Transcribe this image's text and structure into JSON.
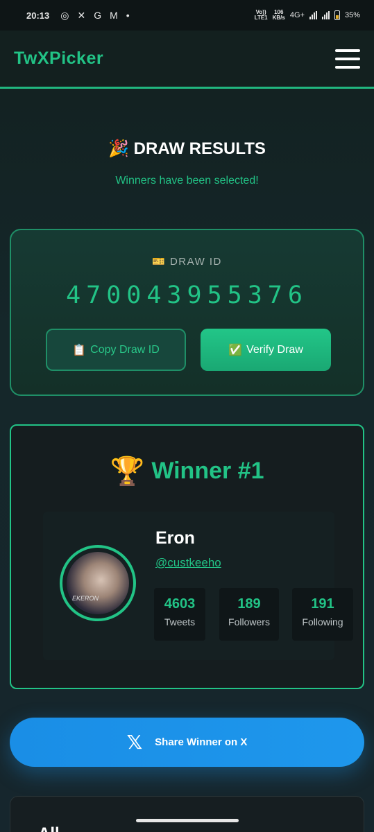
{
  "status_bar": {
    "time": "20:13",
    "icons": [
      "instagram-icon",
      "x-icon",
      "g-icon",
      "gmail-icon"
    ],
    "dot": "•",
    "volte": "Vo))\nLTE1",
    "speed_value": "106",
    "speed_unit": "KB/s",
    "network": "4G+",
    "battery": "35%"
  },
  "header": {
    "brand": "TwXPicker"
  },
  "results": {
    "title_icon": "🎉",
    "title": "DRAW RESULTS",
    "subtitle": "Winners have been selected!"
  },
  "draw": {
    "label_icon": "🎫",
    "label": "DRAW ID",
    "id": "470043955376",
    "copy_icon": "📋",
    "copy_label": "Copy Draw ID",
    "verify_icon": "✅",
    "verify_label": "Verify Draw"
  },
  "winner": {
    "trophy": "🏆",
    "title": "Winner #1",
    "name": "Eron",
    "handle": "@custkeeho",
    "avatar_text": "EKERON",
    "stats": [
      {
        "value": "4603",
        "label": "Tweets"
      },
      {
        "value": "189",
        "label": "Followers"
      },
      {
        "value": "191",
        "label": "Following"
      }
    ]
  },
  "share": {
    "icon": "𝕏",
    "label": "Share Winner on X"
  },
  "bottom": {
    "title": "All"
  },
  "colors": {
    "accent": "#22c386",
    "share_blue": "#1d95eb",
    "background": "#15272a"
  }
}
